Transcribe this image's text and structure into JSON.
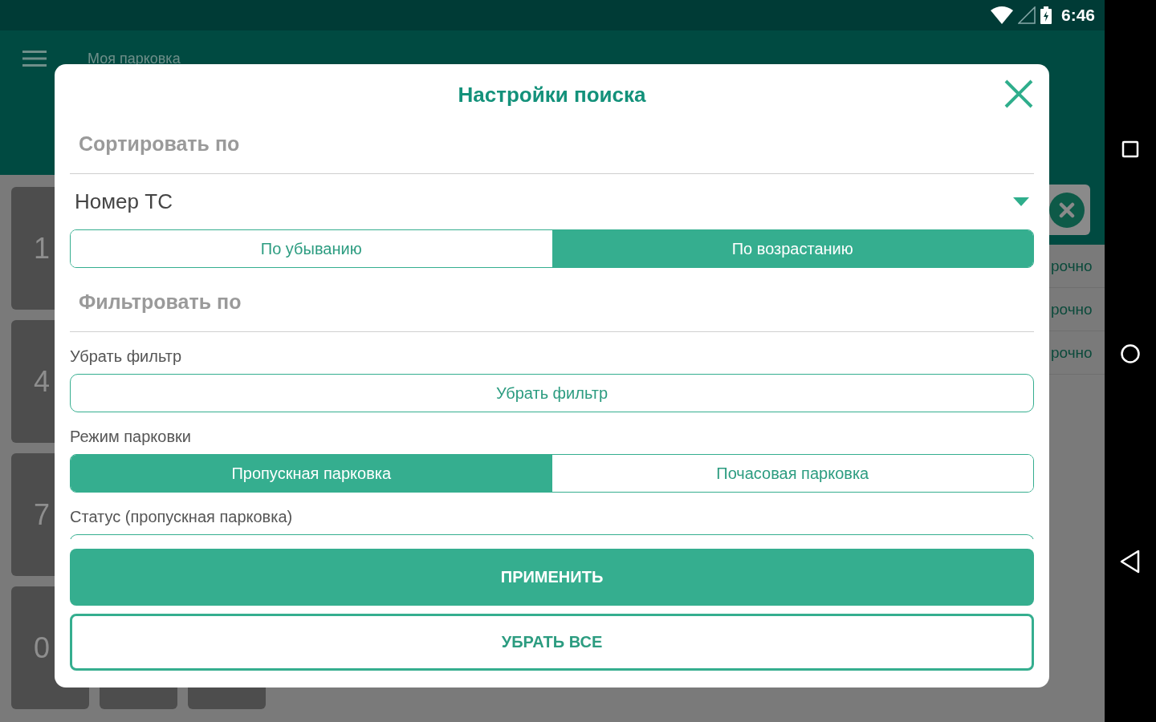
{
  "status_bar": {
    "time": "6:46"
  },
  "app_bar": {
    "title": "Моя парковка"
  },
  "keypad": {
    "keys": [
      "1",
      "4",
      "7",
      "0"
    ]
  },
  "list": {
    "rows": [
      "рочно",
      "рочно",
      "рочно"
    ]
  },
  "dialog": {
    "title": "Настройки поиска",
    "sort": {
      "heading": "Сортировать по",
      "field": {
        "value": "Номер ТС"
      },
      "options": [
        {
          "label": "По убыванию",
          "selected": false
        },
        {
          "label": "По возрастанию",
          "selected": true
        }
      ]
    },
    "filter": {
      "heading": "Фильтровать по",
      "groups": [
        {
          "kind": "button",
          "label": "Убрать фильтр",
          "button": "Убрать фильтр"
        },
        {
          "kind": "segmented",
          "label": "Режим парковки",
          "options": [
            {
              "label": "Пропускная парковка",
              "selected": true
            },
            {
              "label": "Почасовая парковка",
              "selected": false
            }
          ]
        },
        {
          "kind": "clipped",
          "label": "Статус (пропускная парковка)"
        }
      ]
    },
    "buttons": [
      {
        "kind": "primary",
        "label": "ПРИМЕНИТЬ"
      },
      {
        "kind": "outline",
        "label": "УБРАТЬ ВСЕ"
      }
    ]
  }
}
